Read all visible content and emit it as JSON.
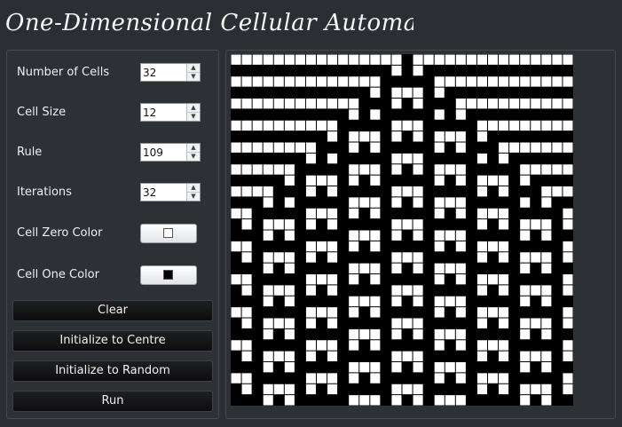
{
  "app": {
    "title": "One-Dimensional Cellular Automaton"
  },
  "controls": {
    "cells_label": "Number of Cells",
    "cells_value": "32",
    "cell_size_label": "Cell Size",
    "cell_size_value": "12",
    "rule_label": "Rule",
    "rule_value": "109",
    "iterations_label": "Iterations",
    "iterations_value": "32",
    "zero_color_label": "Cell Zero Color",
    "zero_color": "#ffffff",
    "one_color_label": "Cell One Color",
    "one_color": "#000000"
  },
  "buttons": {
    "clear": "Clear",
    "init_centre": "Initialize to Centre",
    "init_random": "Initialize to Random",
    "run": "Run"
  },
  "automaton": {
    "rule": 109,
    "cells": 32,
    "iterations": 32,
    "initial": "centre"
  }
}
